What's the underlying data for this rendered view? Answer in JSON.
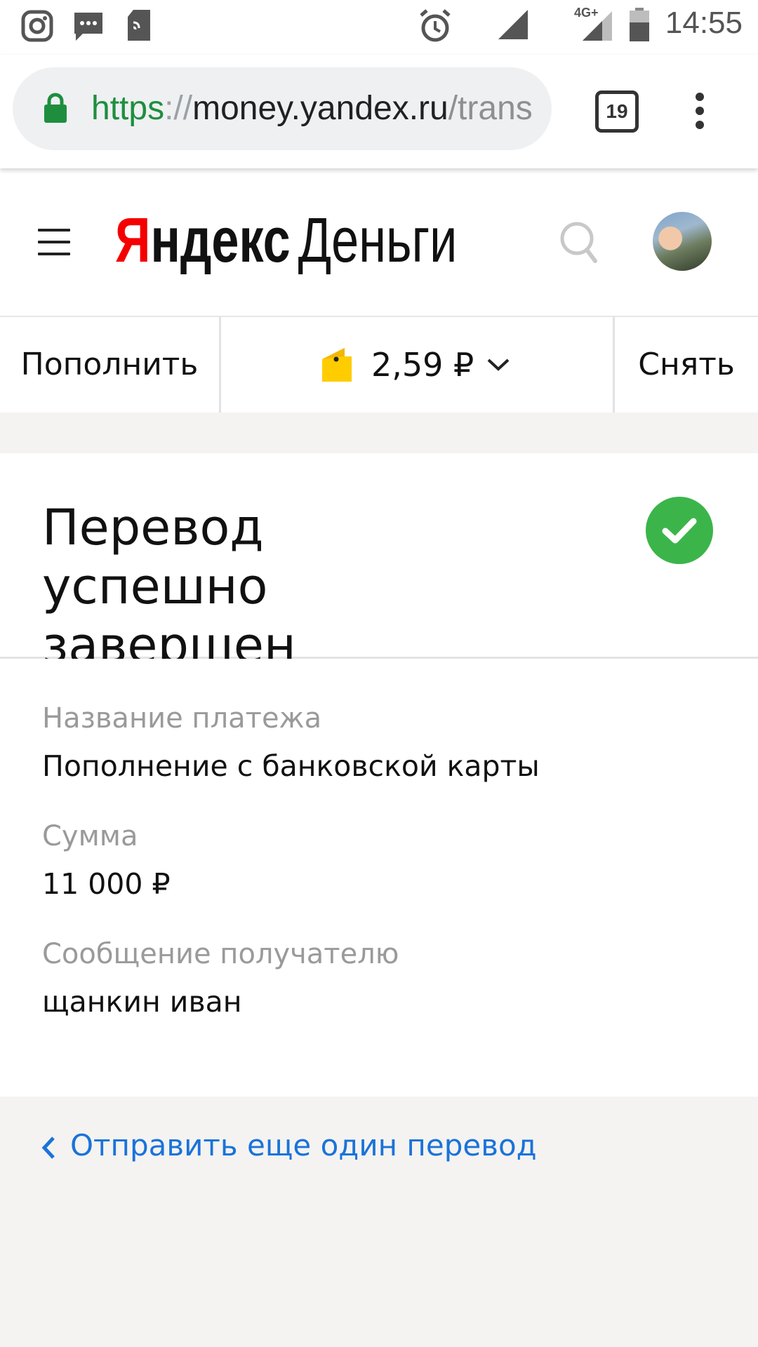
{
  "status_bar": {
    "time": "14:55",
    "network_label": "4G+",
    "icons": [
      "instagram-icon",
      "messages-icon",
      "sim-icon",
      "alarm-icon",
      "signal-icon",
      "signal-4g-icon",
      "battery-icon"
    ]
  },
  "browser": {
    "url": {
      "scheme": "https",
      "separator": "://",
      "host": "money.yandex.ru",
      "path": "/trans"
    },
    "tab_count": "19"
  },
  "header": {
    "logo_ya": "Я",
    "logo_rest": "ндекс",
    "logo_money": "Деньги"
  },
  "balance_bar": {
    "topup_label": "Пополнить",
    "balance": "2,59 ₽",
    "withdraw_label": "Снять"
  },
  "result": {
    "title": "Перевод успешно завершен",
    "status_color": "#3bb54a"
  },
  "details": [
    {
      "label": "Название платежа",
      "value": "Пополнение с банковской карты"
    },
    {
      "label": "Сумма",
      "value": "11 000 ₽"
    },
    {
      "label": "Сообщение получателю",
      "value": "щанкин иван"
    }
  ],
  "action": {
    "label": "Отправить еще один перевод"
  },
  "colors": {
    "link": "#1a73d9",
    "brand_red": "#f40000",
    "wallet_yellow": "#ffcc00",
    "secure_green": "#1e8e3e"
  }
}
